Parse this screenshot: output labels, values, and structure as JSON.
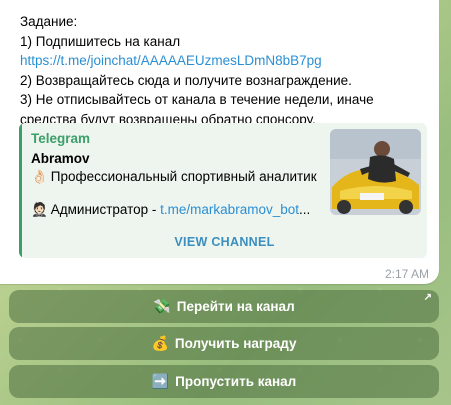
{
  "message": {
    "line1": "Задание:",
    "line2": "1) Подпишитесь на канал",
    "line3_link": "https://t.me/joinchat/AAAAAEUzmesLDmN8bB7pg",
    "line4": "2) Возвращайтесь сюда и получите вознаграждение.",
    "line5": "3) Не отписывайтесь от канала в течение недели, иначе средства будут возвращены обратно спонсору.",
    "time": "2:17 AM"
  },
  "preview": {
    "site": "Telegram",
    "title": "Abramov",
    "desc1_emoji": "👌🏻",
    "desc1": "Профессиональный спортивный аналитик",
    "desc2_emoji": "🤵🏻",
    "desc2_text": "Администратор - ",
    "desc2_link": "t.me/markabramov_bot",
    "desc2_suffix": "...",
    "view_button": "VIEW CHANNEL"
  },
  "keyboard": {
    "btn1_icon": "💸",
    "btn1_label": "Перейти на канал",
    "btn1_corner": "↗",
    "btn2_icon": "💰",
    "btn2_label": "Получить награду",
    "btn3_icon": "➡️",
    "btn3_label": "Пропустить канал"
  },
  "colors": {
    "link": "#2b8fd3",
    "accent_green": "#3a9f68",
    "button_bg": "rgba(76,110,62,.55)"
  }
}
